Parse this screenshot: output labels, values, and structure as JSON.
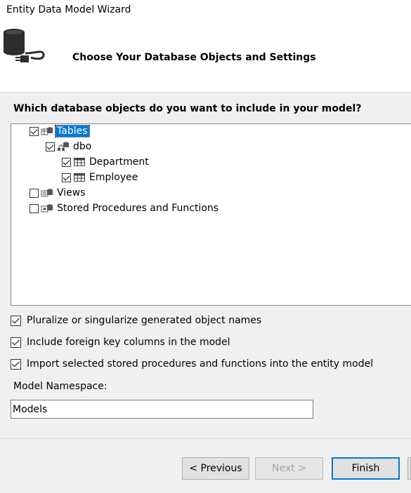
{
  "window": {
    "title": "Entity Data Model Wizard"
  },
  "banner": {
    "icon": "database-connection-icon",
    "heading": "Choose Your Database Objects and Settings"
  },
  "tree": {
    "question": "Which database objects do you want to include in your model?",
    "items": [
      {
        "label": "Tables",
        "checked": true,
        "selected": true,
        "icon": "tables-folder-icon"
      },
      {
        "label": "dbo",
        "checked": true,
        "icon": "schema-icon"
      },
      {
        "label": "Department",
        "checked": true,
        "icon": "table-icon"
      },
      {
        "label": "Employee",
        "checked": true,
        "icon": "table-icon"
      },
      {
        "label": "Views",
        "checked": false,
        "icon": "views-folder-icon"
      },
      {
        "label": "Stored Procedures and Functions",
        "checked": false,
        "icon": "procedures-folder-icon"
      }
    ]
  },
  "options": [
    {
      "label": "Pluralize or singularize generated object names",
      "checked": true
    },
    {
      "label": "Include foreign key columns in the model",
      "checked": true
    },
    {
      "label": "Import selected stored procedures and functions into the entity model",
      "checked": true
    }
  ],
  "namespace": {
    "label": "Model Namespace:",
    "value": "Models"
  },
  "buttons": {
    "previous": "< Previous",
    "next": "Next >",
    "finish": "Finish"
  },
  "colors": {
    "selection": "#0078d7",
    "dialog_bg": "#f0f0f0",
    "banner_bg": "#ffffff"
  }
}
